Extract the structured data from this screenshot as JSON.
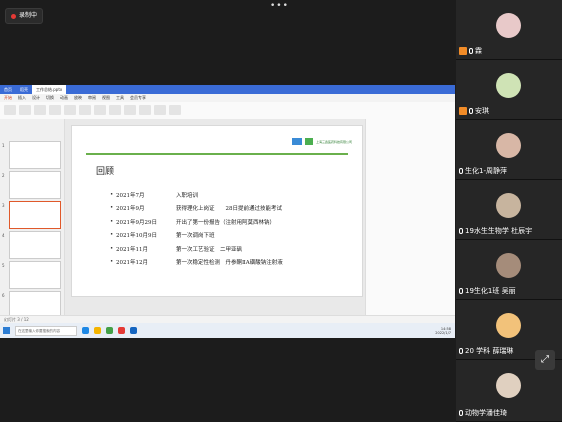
{
  "recording": {
    "label": "录制中"
  },
  "more": {
    "label": "•••"
  },
  "window": {
    "tabs": [
      "首页",
      "稻壳",
      "工作总结.pptx"
    ],
    "ribbon_tabs": [
      "开始",
      "插入",
      "设计",
      "切换",
      "动画",
      "放映",
      "审阅",
      "视图",
      "工具",
      "会员专享"
    ]
  },
  "slide": {
    "title": "回顾",
    "logo_text": "上海三鑫医药科技有限公司",
    "items": [
      {
        "date": "2021年7月",
        "text": "入职培训"
      },
      {
        "date": "2021年9月",
        "text": "获得理化上岗证　　28日提前通过技能考试"
      },
      {
        "date": "2021年9月29日",
        "text": "开出了第一份报告（注射用阿莫西林钠）"
      },
      {
        "date": "2021年10月9日",
        "text": "第一次调岗下班"
      },
      {
        "date": "2021年11月",
        "text": "第一次工艺验证　二甲亚砜"
      },
      {
        "date": "2021年12月",
        "text": "第一次稳定性检测　丹参酮ⅡA磺酸钠注射液"
      }
    ]
  },
  "thumbnails": [
    "1",
    "2",
    "3",
    "4",
    "5",
    "6"
  ],
  "status": {
    "left": "幻灯片 3 / 12"
  },
  "taskbar": {
    "search_placeholder": "在这里输入你要搜索的内容",
    "time": "14:58",
    "date": "2022/1/7"
  },
  "participants": [
    {
      "name": "霖",
      "avatar_color": "#e8c9c9",
      "host": true
    },
    {
      "name": "安琪",
      "avatar_color": "#cfe3b5",
      "host": true
    },
    {
      "name": "生化1-周静萍",
      "avatar_color": "#d8b7a6",
      "host": false
    },
    {
      "name": "19水生生物学 杜辰宇",
      "avatar_color": "#c7b49e",
      "host": false
    },
    {
      "name": "19生化1班 吴丽",
      "avatar_color": "#a58c7a",
      "host": false
    },
    {
      "name": "20 学科 薛瑞琳",
      "avatar_color": "#f2c27a",
      "host": false
    },
    {
      "name": "动物学潘佳琦",
      "avatar_color": "#e0d0c0",
      "host": false
    }
  ],
  "fullscreen": {
    "icon": "expand-icon"
  }
}
